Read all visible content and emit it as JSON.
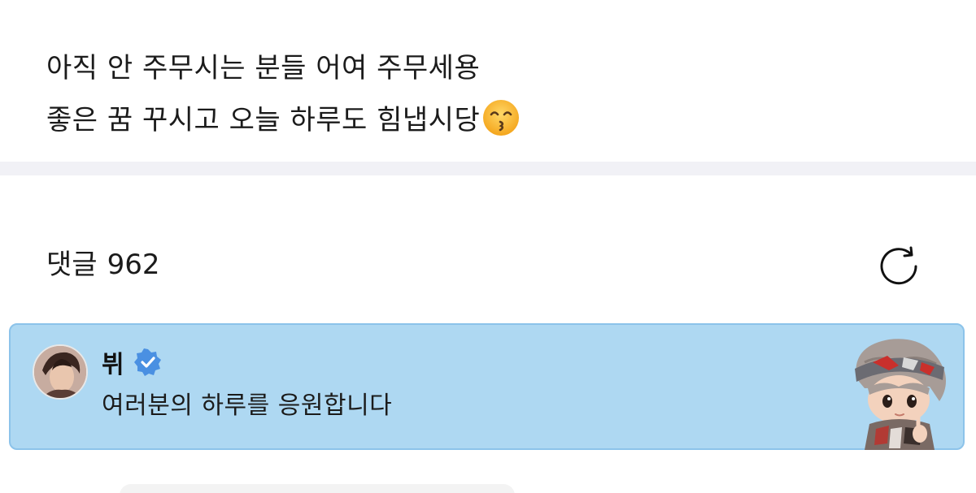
{
  "post": {
    "line1": "아직 안 주무시는 분들 어여 주무세용",
    "line2": "좋은 꿈 꾸시고 오늘 하루도 힘냅시당",
    "emoji": "kissing-face-with-smiling-eyes"
  },
  "comments": {
    "label": "댓글",
    "count": "962",
    "refresh_icon": "refresh-icon"
  },
  "pinned_comment": {
    "author": "뷔",
    "verified": true,
    "text": "여러분의 하루를 응원합니다",
    "avatar_icon": "avatar",
    "sticker_icon": "character-sticker"
  },
  "colors": {
    "card_bg": "#aed8f2",
    "card_border": "#8cc3ea",
    "verified_blue": "#4a90e2",
    "divider": "#f1f1f6"
  }
}
